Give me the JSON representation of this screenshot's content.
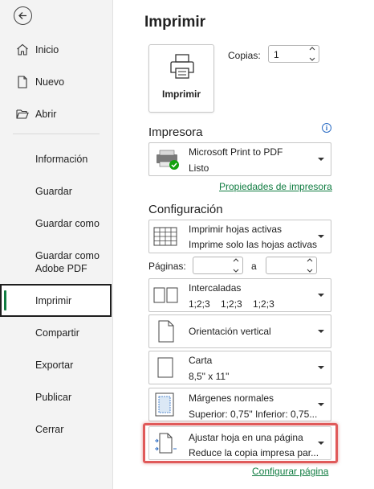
{
  "sidebar": {
    "back_label": "",
    "items": [
      {
        "label": "Inicio",
        "icon": "home-icon"
      },
      {
        "label": "Nuevo",
        "icon": "new-document-icon"
      },
      {
        "label": "Abrir",
        "icon": "open-folder-icon"
      },
      {
        "label": "Información"
      },
      {
        "label": "Guardar"
      },
      {
        "label": "Guardar como"
      },
      {
        "label": "Guardar como Adobe PDF"
      },
      {
        "label": "Imprimir",
        "selected": true
      },
      {
        "label": "Compartir"
      },
      {
        "label": "Exportar"
      },
      {
        "label": "Publicar"
      },
      {
        "label": "Cerrar"
      }
    ]
  },
  "main": {
    "title": "Imprimir",
    "print_button_label": "Imprimir",
    "copies": {
      "label": "Copias:",
      "value": "1"
    },
    "printer_section": {
      "heading": "Impresora",
      "name": "Microsoft Print to PDF",
      "status": "Listo",
      "properties_link": "Propiedades de impresora"
    },
    "config_section": {
      "heading": "Configuración",
      "scope": {
        "title": "Imprimir hojas activas",
        "subtitle": "Imprime solo las hojas activas"
      },
      "pages": {
        "label": "Páginas:",
        "to_label": "a",
        "from_value": "",
        "to_value": ""
      },
      "collation": {
        "title": "Intercaladas",
        "subtitle": "1;2;3    1;2;3    1;2;3"
      },
      "orientation": {
        "title": "Orientación vertical"
      },
      "paper": {
        "title": "Carta",
        "subtitle": "8,5\" x 11\""
      },
      "margins": {
        "title": "Márgenes normales",
        "subtitle": "Superior: 0,75\" Inferior: 0,75..."
      },
      "scaling": {
        "title": "Ajustar hoja en una página",
        "subtitle": "Reduce la copia impresa par..."
      },
      "page_setup_link": "Configurar página"
    }
  },
  "colors": {
    "accent": "#107c41",
    "highlight": "#e05a5a",
    "info": "#2b6cc4"
  }
}
